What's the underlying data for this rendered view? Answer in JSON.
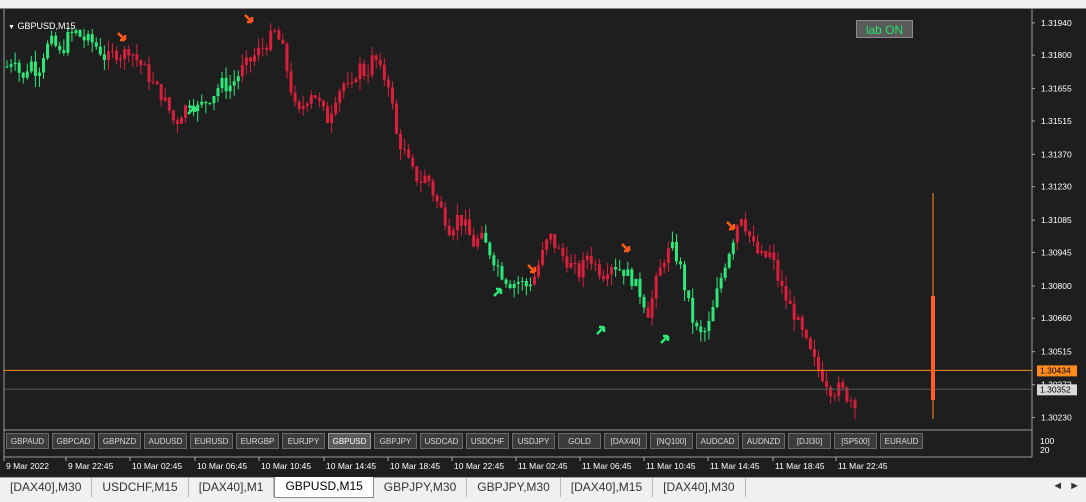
{
  "chart_title": "GBPUSD,M15",
  "lab_button": "lab ON",
  "price_axis": [
    "1.31940",
    "1.31800",
    "1.31655",
    "1.31515",
    "1.31370",
    "1.31230",
    "1.31085",
    "1.30945",
    "1.30800",
    "1.30660",
    "1.30515",
    "1.30372",
    "1.30230"
  ],
  "current_price_label": "1.30434",
  "bid_label": "1.30352",
  "indicator_axis": [
    "100",
    "20"
  ],
  "time_axis": [
    "9 Mar 2022",
    "9 Mar 22:45",
    "10 Mar 02:45",
    "10 Mar 06:45",
    "10 Mar 10:45",
    "10 Mar 14:45",
    "10 Mar 18:45",
    "10 Mar 22:45",
    "11 Mar 02:45",
    "11 Mar 06:45",
    "11 Mar 10:45",
    "11 Mar 14:45",
    "11 Mar 18:45",
    "11 Mar 22:45"
  ],
  "symbol_buttons": [
    "GBPAUD",
    "GBPCAD",
    "GBPNZD",
    "AUDUSD",
    "EURUSD",
    "EURGBP",
    "EURJPY",
    "GBPUSD",
    "GBPJPY",
    "USDCAD",
    "USDCHF",
    "USDJPY",
    "GOLD",
    "[DAX40]",
    "[NQ100]",
    "AUDCAD",
    "AUDNZD",
    "[DJI30]",
    "[SP500]",
    "EURAUD"
  ],
  "selected_symbol": "GBPUSD",
  "tabs": [
    "[DAX40],M30",
    "USDCHF,M15",
    "[DAX40],M1",
    "GBPUSD,M15",
    "GBPJPY,M30",
    "GBPJPY,M30",
    "[DAX40],M15",
    "[DAX40],M30"
  ],
  "active_tab": "GBPUSD,M15",
  "tab_scroll": [
    "◄",
    "►"
  ],
  "colors": {
    "bull": "#2ee87a",
    "bear": "#d8203c",
    "sell_arrow": "#ff5a1a",
    "buy_arrow": "#2ee87a",
    "price_line": "#ff8c1a",
    "bid_line": "#5a5a5a"
  },
  "chart_data": {
    "type": "candlestick",
    "symbol": "GBPUSD",
    "timeframe": "M15",
    "ylim": [
      1.3018,
      1.32
    ],
    "close_series": [
      1.3175,
      1.318,
      1.3168,
      1.3178,
      1.3172,
      1.3183,
      1.3186,
      1.318,
      1.3188,
      1.319,
      1.3187,
      1.3186,
      1.3183,
      1.3178,
      1.3181,
      1.318,
      1.3183,
      1.3178,
      1.3174,
      1.3168,
      1.3164,
      1.3158,
      1.315,
      1.3156,
      1.316,
      1.3157,
      1.316,
      1.3163,
      1.3168,
      1.3166,
      1.317,
      1.3175,
      1.3178,
      1.3182,
      1.3185,
      1.319,
      1.3184,
      1.3168,
      1.3153,
      1.316,
      1.3165,
      1.3158,
      1.3152,
      1.3162,
      1.3168,
      1.3164,
      1.3176,
      1.3171,
      1.318,
      1.3172,
      1.3168,
      1.3145,
      1.3138,
      1.313,
      1.3125,
      1.3128,
      1.3118,
      1.3112,
      1.3104,
      1.311,
      1.3106,
      1.3098,
      1.3101,
      1.3096,
      1.309,
      1.3084,
      1.3081,
      1.3082,
      1.308,
      1.3084,
      1.3093,
      1.3102,
      1.3096,
      1.3092,
      1.3088,
      1.3085,
      1.3094,
      1.3089,
      1.3085,
      1.309,
      1.3088,
      1.3086,
      1.3082,
      1.3076,
      1.3068,
      1.3082,
      1.3092,
      1.3097,
      1.309,
      1.3075,
      1.3062,
      1.3058,
      1.3064,
      1.3078,
      1.309,
      1.31,
      1.3112,
      1.3103,
      1.3095,
      1.3092,
      1.3094,
      1.3082,
      1.3074,
      1.3068,
      1.306,
      1.3052,
      1.3045,
      1.304,
      1.3034,
      1.3036,
      1.3032,
      1.303
    ],
    "sell_signals": 6,
    "buy_signals": 6,
    "current_price": 1.30434,
    "bid_price": 1.30352
  }
}
